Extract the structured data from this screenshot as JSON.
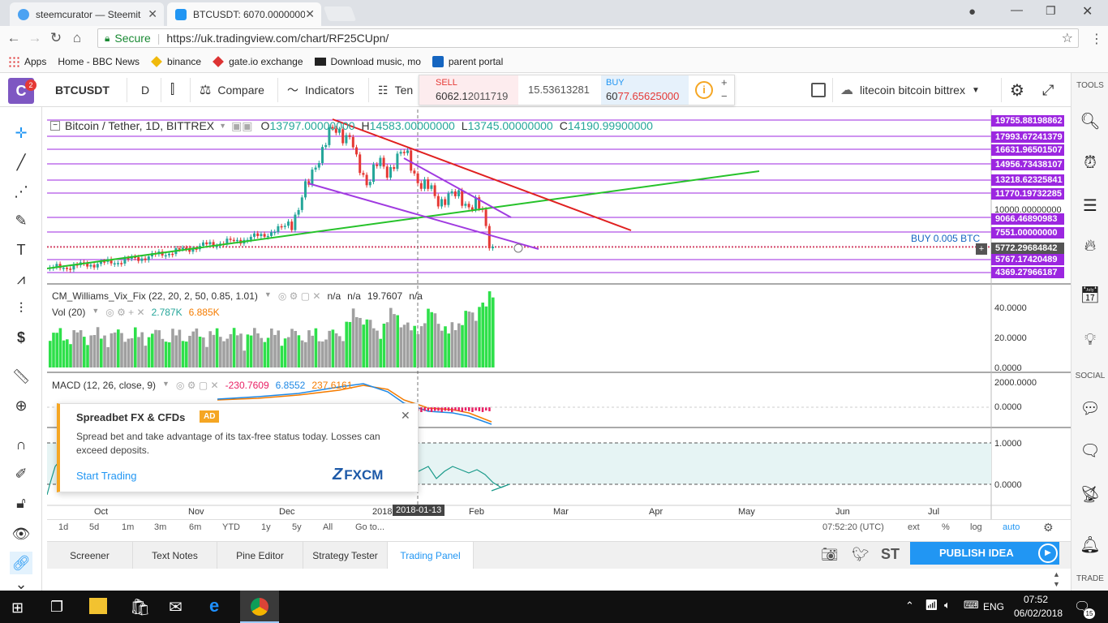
{
  "browser": {
    "tabs": [
      {
        "label": "steemcurator — Steemit"
      },
      {
        "label": "BTCUSDT: 6070.0000000"
      }
    ],
    "secure_label": "Secure",
    "url": "https://uk.tradingview.com/chart/RF25CUpn/",
    "bookmarks": [
      "Apps",
      "Home - BBC News",
      "binance",
      "gate.io exchange",
      "Download music, mo",
      "parent portal"
    ]
  },
  "toolbar": {
    "symbol": "BTCUSDT",
    "interval": "D",
    "compare": "Compare",
    "indicators": "Indicators",
    "templates": "Ten",
    "avatar_badge": "2",
    "sell_label": "SELL",
    "sell_price_a": "6062.1",
    "sell_price_b": "2011719",
    "spread": "15.53613281",
    "buy_label": "BUY",
    "buy_price_a": "60",
    "buy_price_b": "77.65625000",
    "plus": "+",
    "minus": "−",
    "layout_name": "litecoin bitcoin bittrex"
  },
  "legend": {
    "title": "Bitcoin / Tether, 1D, BITTREX",
    "o_label": "O",
    "o_value": "13797.00000000",
    "h_label": "H",
    "h_value": "14583.00000000",
    "l_label": "L",
    "l_value": "13745.00000000",
    "c_label": "C",
    "c_value": "14190.99900000",
    "trade_label": "BUY 0.005 BTC"
  },
  "price_labels": [
    "19755.88198862",
    "17993.67241379",
    "16631.96501507",
    "14956.73438107",
    "13218.62325841",
    "11770.19732285",
    "10000.00000000",
    "9066.46890983",
    "7551.00000000",
    "5772.29684842",
    "5767.17420489",
    "4369.27966187"
  ],
  "indicators": {
    "vix": {
      "name": "CM_Williams_Vix_Fix (22, 20, 2, 50, 0.85, 1.01)",
      "v1": "n/a",
      "v2": "n/a",
      "v3": "19.7607",
      "v4": "n/a"
    },
    "vol": {
      "name": "Vol (20)",
      "v1": "2.787K",
      "v2": "6.885K",
      "axis": [
        "40.0000",
        "20.0000",
        "0.0000"
      ]
    },
    "macd": {
      "name": "MACD (12, 26, close, 9)",
      "v1": "-230.7609",
      "v2": "6.8552",
      "v3": "237.6161",
      "axis": [
        "2000.0000",
        "0.0000"
      ]
    },
    "bottom": {
      "axis": [
        "1.0000",
        "0.0000"
      ]
    }
  },
  "ad": {
    "title": "Spreadbet FX & CFDs",
    "badge": "AD",
    "body": "Spread bet and take advantage of its tax-free status today. Losses can exceed deposits.",
    "cta": "Start Trading",
    "brand": "FXCM"
  },
  "time_axis": {
    "labels": [
      "Oct",
      "Nov",
      "Dec",
      "2018",
      "Feb",
      "Mar",
      "Apr",
      "May",
      "Jun",
      "Jul"
    ],
    "cursor": "2018-01-13"
  },
  "range_bar": {
    "ranges": [
      "1d",
      "5d",
      "1m",
      "3m",
      "6m",
      "YTD",
      "1y",
      "5y",
      "All"
    ],
    "goto": "Go to...",
    "time": "07:52:20 (UTC)",
    "options": [
      "ext",
      "%",
      "log",
      "auto"
    ]
  },
  "bottom_tabs": [
    "Screener",
    "Text Notes",
    "Pine Editor",
    "Strategy Tester",
    "Trading Panel"
  ],
  "publish": "PUBLISH IDEA",
  "bottom_icon_st": "ST",
  "right_panel": {
    "tools": "TOOLS",
    "social": "SOCIAL",
    "trade": "TRADE"
  },
  "taskbar": {
    "time": "07:52",
    "date": "06/02/2018",
    "lang": "ENG",
    "notif": "15"
  },
  "colors": {
    "accent": "#2196f3",
    "level": "#9c27e0",
    "green": "#26c22a",
    "red": "#e02020",
    "purple": "#a03ae0"
  }
}
